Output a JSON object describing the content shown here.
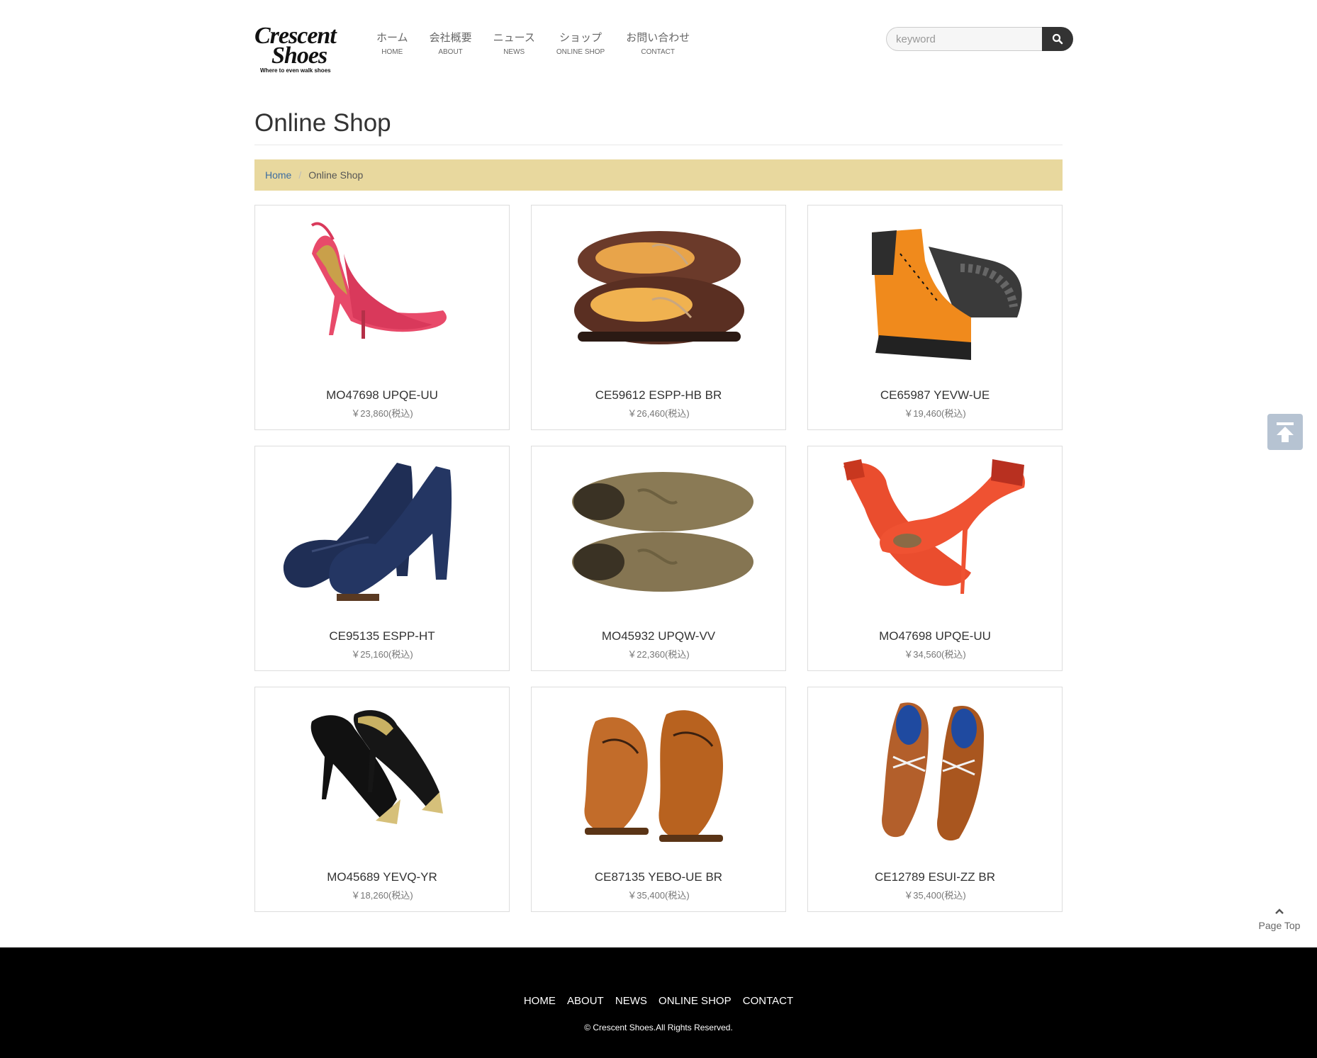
{
  "brand": {
    "line1": "Crescent",
    "line2": "Shoes",
    "tagline": "Where to even walk shoes"
  },
  "nav": [
    {
      "jp": "ホーム",
      "en": "HOME"
    },
    {
      "jp": "会社概要",
      "en": "ABOUT"
    },
    {
      "jp": "ニュース",
      "en": "NEWS"
    },
    {
      "jp": "ショップ",
      "en": "ONLINE SHOP"
    },
    {
      "jp": "お問い合わせ",
      "en": "CONTACT"
    }
  ],
  "search": {
    "placeholder": "keyword",
    "icon": "search-icon"
  },
  "page": {
    "title": "Online Shop"
  },
  "breadcrumb": {
    "home": "Home",
    "separator": "/",
    "current": "Online Shop"
  },
  "products": [
    {
      "name": "MO47698 UPQE-UU",
      "price": "￥23,860(税込)",
      "image": "pink-slingback-heel"
    },
    {
      "name": "CE59612 ESPP-HB BR",
      "price": "￥26,460(税込)",
      "image": "brown-boat-shoes"
    },
    {
      "name": "CE65987 YEVW-UE",
      "price": "￥19,460(税込)",
      "image": "orange-hiking-boots"
    },
    {
      "name": "CE95135 ESPP-HT",
      "price": "￥25,160(税込)",
      "image": "navy-platform-pumps"
    },
    {
      "name": "MO45932 UPQW-VV",
      "price": "￥22,360(税込)",
      "image": "suede-lace-up-shoes"
    },
    {
      "name": "MO47698 UPQE-UU",
      "price": "￥34,560(税込)",
      "image": "red-bow-heels"
    },
    {
      "name": "MO45689 YEVQ-YR",
      "price": "￥18,260(税込)",
      "image": "black-gold-pumps"
    },
    {
      "name": "CE87135 YEBO-UE BR",
      "price": "￥35,400(税込)",
      "image": "tan-oxford-shoes"
    },
    {
      "name": "CE12789 ESUI-ZZ BR",
      "price": "￥35,400(税込)",
      "image": "woven-brown-oxfords"
    }
  ],
  "page_top": {
    "label": "Page Top"
  },
  "footer": {
    "nav": [
      "HOME",
      "ABOUT",
      "NEWS",
      "ONLINE SHOP",
      "CONTACT"
    ],
    "copyright": "© Crescent Shoes.All Rights Reserved."
  },
  "colors": {
    "breadcrumb_bg": "#e8d89e",
    "link": "#3c6da1",
    "footer_bg": "#000000",
    "search_button": "#333333",
    "to_top_button": "#b6c3d2"
  }
}
